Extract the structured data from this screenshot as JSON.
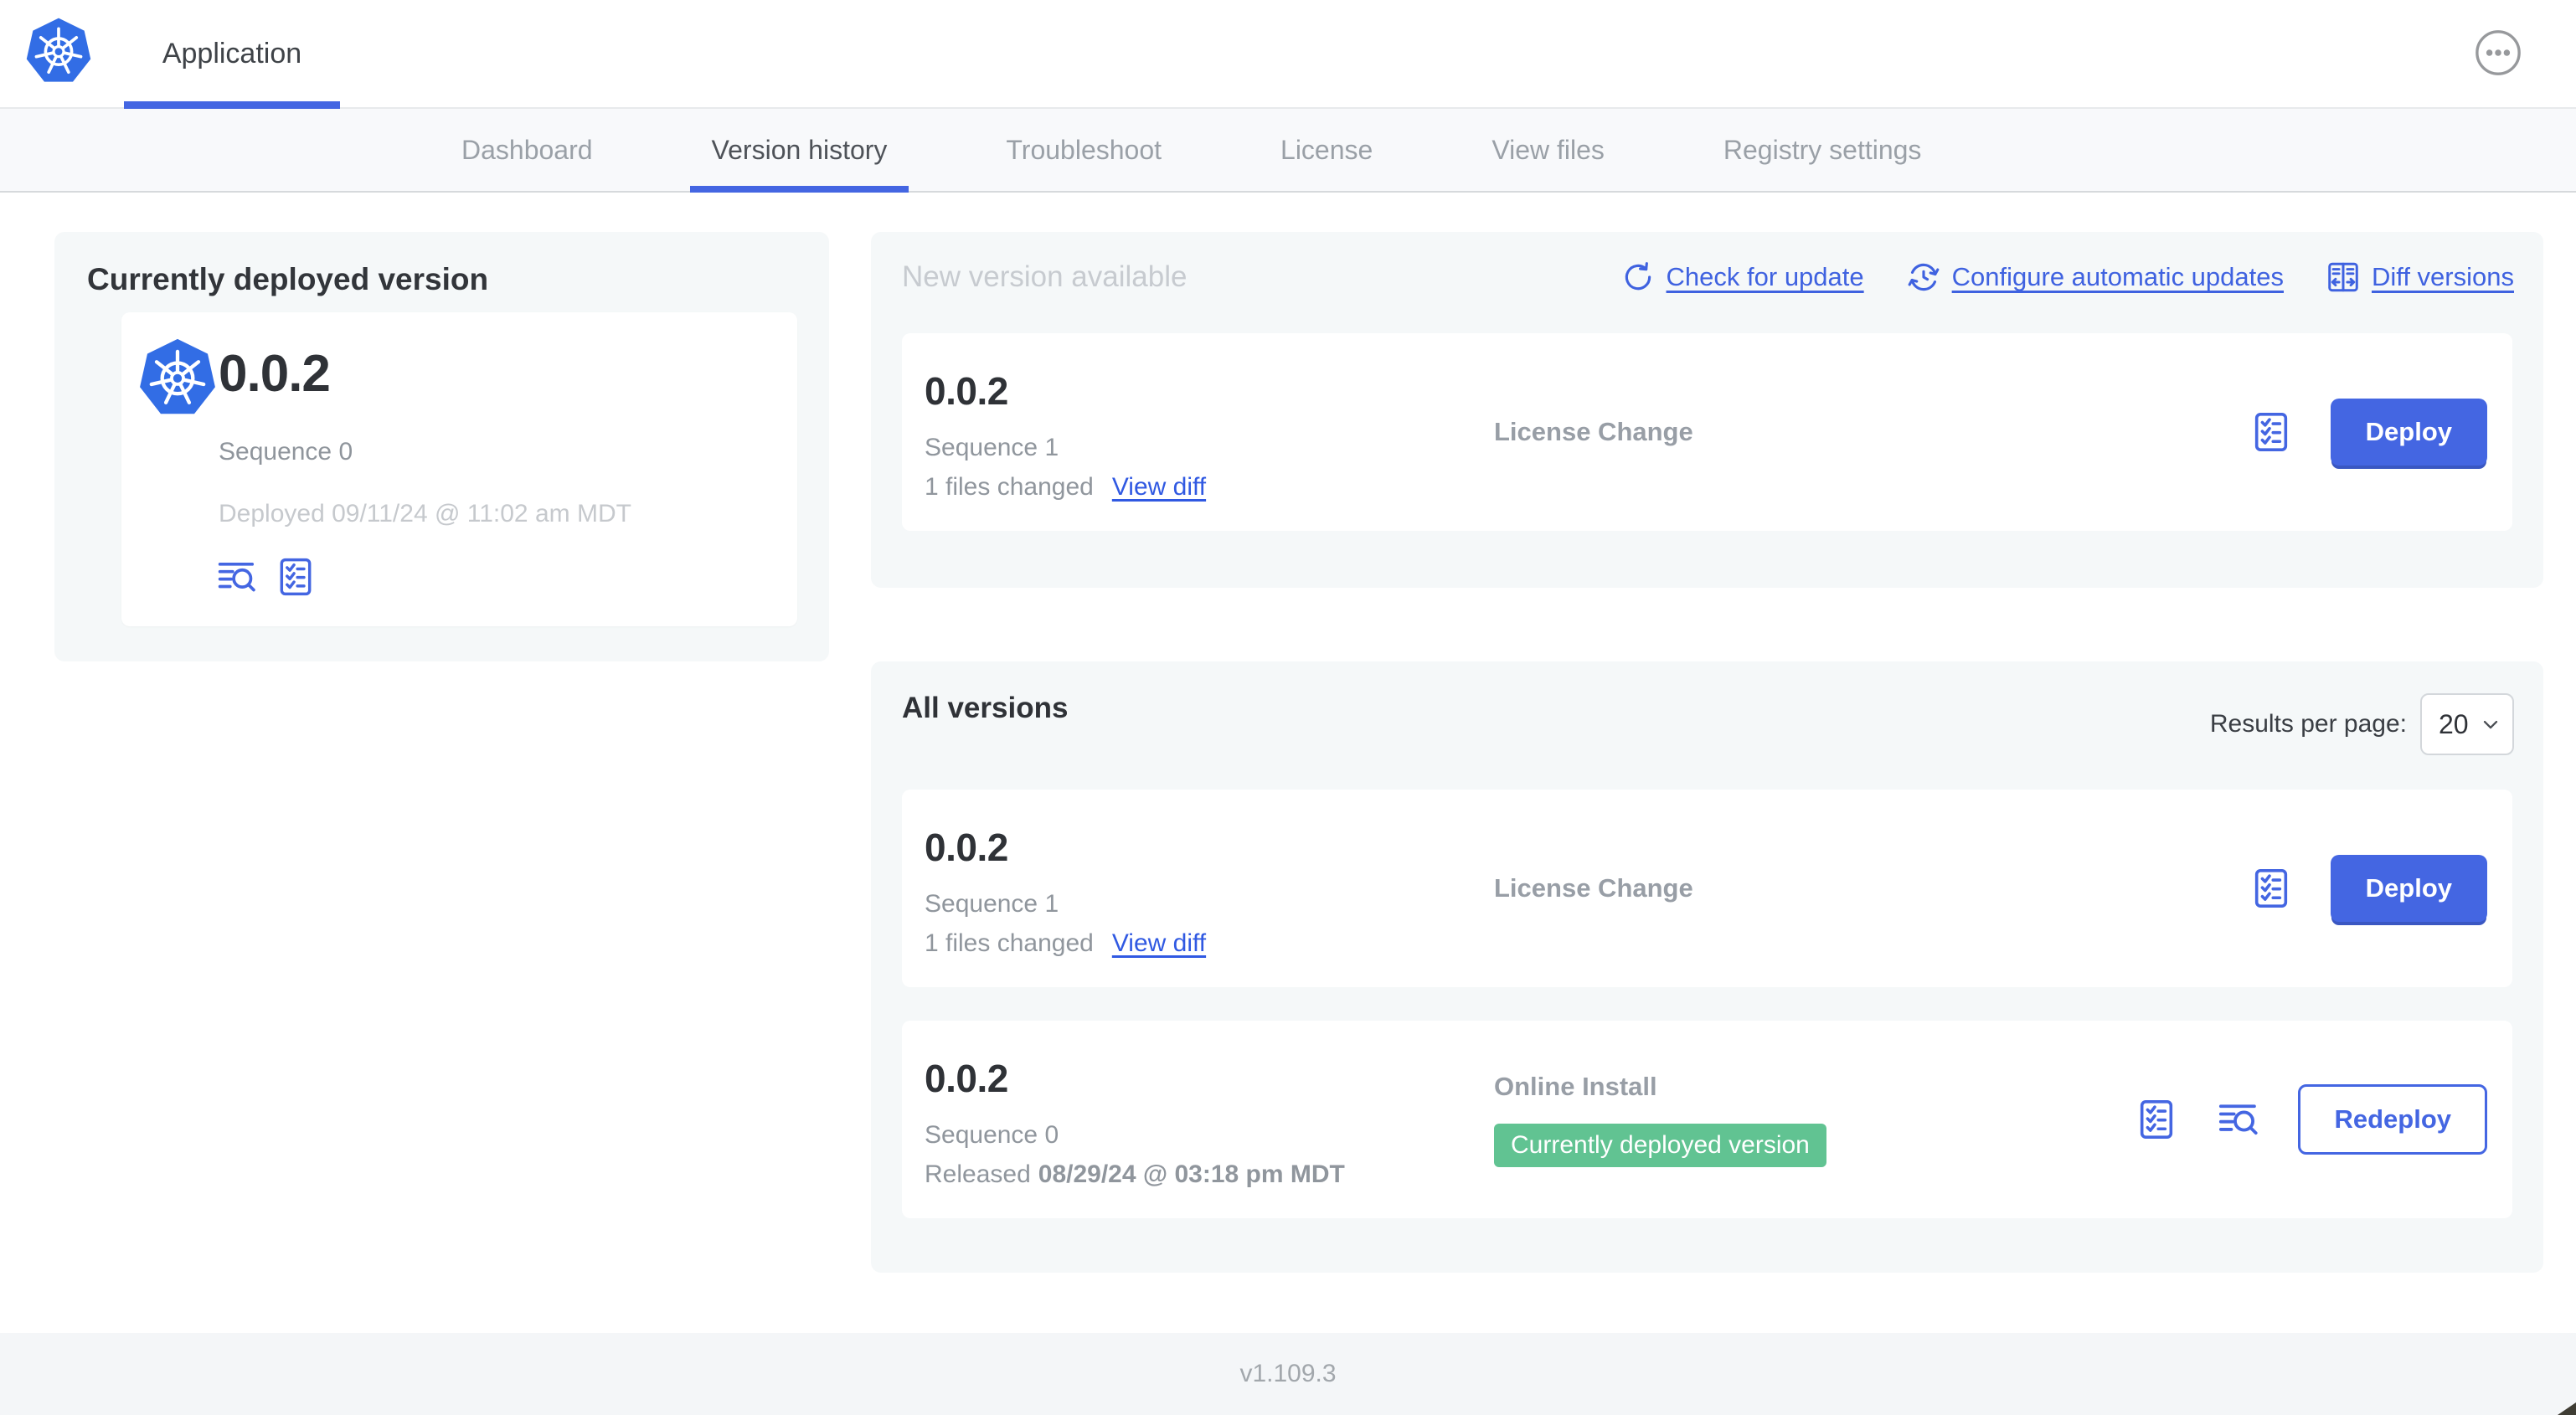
{
  "header": {
    "app_tab_label": "Application"
  },
  "nav": {
    "tabs": [
      {
        "label": "Dashboard",
        "active": false
      },
      {
        "label": "Version history",
        "active": true
      },
      {
        "label": "Troubleshoot",
        "active": false
      },
      {
        "label": "License",
        "active": false
      },
      {
        "label": "View files",
        "active": false
      },
      {
        "label": "Registry settings",
        "active": false
      }
    ]
  },
  "current_version_card": {
    "title": "Currently deployed version",
    "version": "0.0.2",
    "sequence": "Sequence 0",
    "deployed": "Deployed 09/11/24 @ 11:02 am MDT"
  },
  "new_version_section": {
    "title": "New version available",
    "check_for_update": "Check for update",
    "configure_updates": "Configure automatic updates",
    "diff_versions": "Diff versions",
    "row": {
      "version": "0.0.2",
      "sequence": "Sequence 1",
      "files_changed": "1 files changed",
      "view_diff": "View diff",
      "source": "License Change",
      "action": "Deploy"
    }
  },
  "all_versions_section": {
    "title": "All versions",
    "results_per_page_label": "Results per page:",
    "results_per_page_value": "20",
    "rows": [
      {
        "version": "0.0.2",
        "sequence": "Sequence 1",
        "files_changed": "1 files changed",
        "view_diff": "View diff",
        "source": "License Change",
        "action": "Deploy"
      },
      {
        "version": "0.0.2",
        "sequence": "Sequence 0",
        "released_label": "Released",
        "released_date": "08/29/24 @ 03:18 pm MDT",
        "source": "Online Install",
        "badge": "Currently deployed version",
        "action": "Redeploy"
      }
    ]
  },
  "footer": {
    "app_version": "v1.109.3"
  },
  "colors": {
    "accent_blue": "#4466e2",
    "kubernetes_blue": "#326de5",
    "badge_green": "#61c392"
  }
}
